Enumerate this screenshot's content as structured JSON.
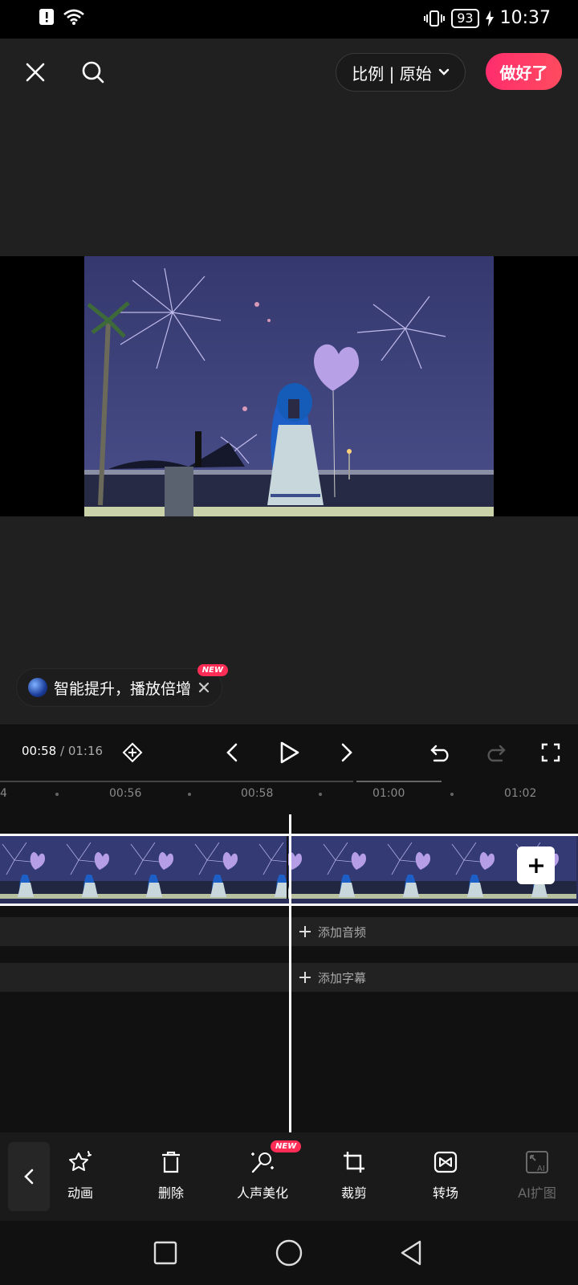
{
  "status": {
    "battery": "93",
    "time": "10:37"
  },
  "topbar": {
    "ratio_label": "比例 | 原始",
    "done_label": "做好了"
  },
  "promo": {
    "text": "智能提升，播放倍增",
    "badge": "NEW"
  },
  "controls": {
    "current_time": "00:58",
    "separator": " / ",
    "duration": "01:16"
  },
  "ruler": {
    "labels": [
      "4",
      "00:56",
      "00:58",
      "01:00",
      "01:02"
    ]
  },
  "tracks": {
    "audio_label": "添加音频",
    "subtitle_label": "添加字幕"
  },
  "toolbar": {
    "items": [
      {
        "label": "动画",
        "icon": "star-sparkle-icon"
      },
      {
        "label": "删除",
        "icon": "trash-icon"
      },
      {
        "label": "人声美化",
        "icon": "magic-mic-icon",
        "badge": "NEW"
      },
      {
        "label": "裁剪",
        "icon": "crop-icon"
      },
      {
        "label": "转场",
        "icon": "transition-icon"
      },
      {
        "label": "AI扩图",
        "icon": "ai-expand-icon",
        "disabled": true
      }
    ]
  }
}
